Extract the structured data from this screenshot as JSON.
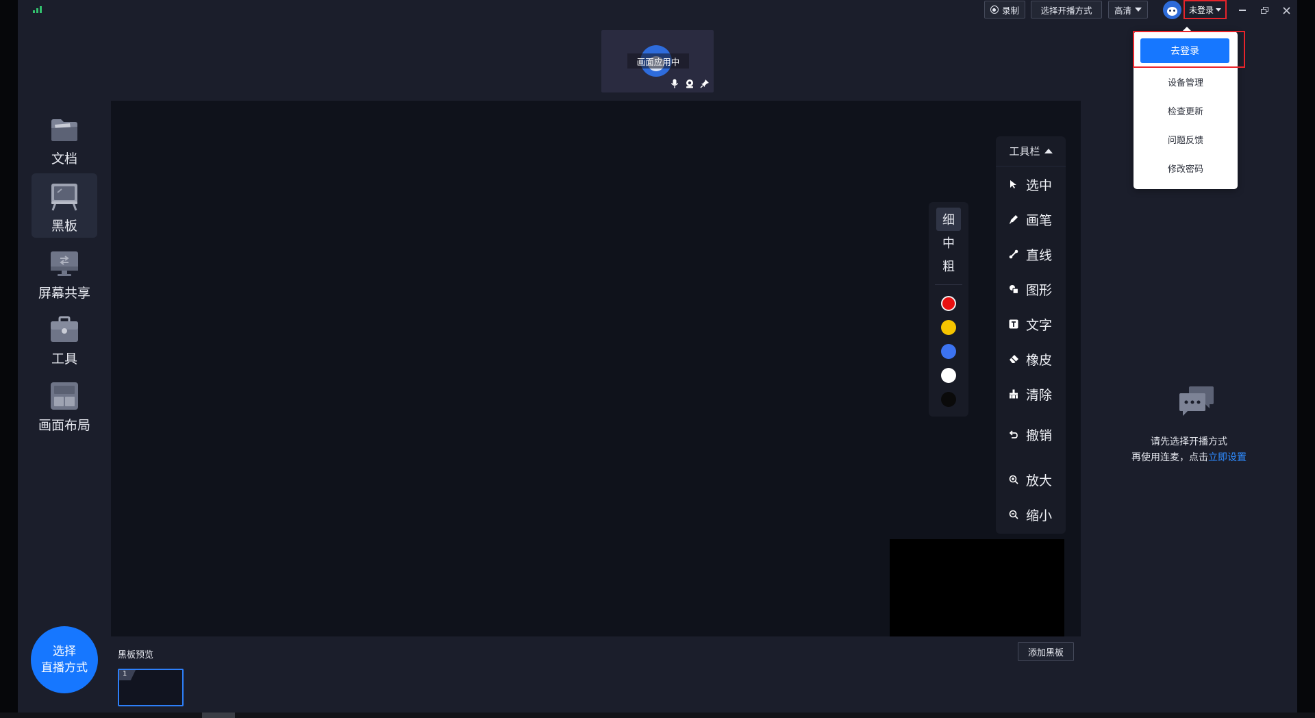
{
  "titlebar": {
    "record_label": "录制",
    "broadcast_mode_label": "选择开播方式",
    "quality_label": "高清",
    "login_status_label": "未登录"
  },
  "video": {
    "status_label": "画面应用中"
  },
  "sidebar": {
    "items": [
      {
        "label": "文档",
        "icon": "folder-icon"
      },
      {
        "label": "黑板",
        "icon": "blackboard-icon"
      },
      {
        "label": "屏幕共享",
        "icon": "monitor-icon"
      },
      {
        "label": "工具",
        "icon": "toolbox-icon"
      },
      {
        "label": "画面布局",
        "icon": "layout-icon"
      }
    ],
    "active_index": 1,
    "cta_line1": "选择",
    "cta_line2": "直播方式"
  },
  "pen_panel": {
    "widths": [
      "细",
      "中",
      "粗"
    ],
    "selected_width": "细",
    "colors": [
      "#e81010",
      "#f5c400",
      "#3c73f0",
      "#ffffff",
      "#0a0a0a"
    ]
  },
  "toolbar": {
    "title": "工具栏",
    "tools": [
      {
        "label": "选中",
        "icon": "cursor-icon"
      },
      {
        "label": "画笔",
        "icon": "pen-icon"
      },
      {
        "label": "直线",
        "icon": "line-icon"
      },
      {
        "label": "图形",
        "icon": "shape-icon"
      },
      {
        "label": "文字",
        "icon": "text-icon"
      },
      {
        "label": "橡皮",
        "icon": "eraser-icon"
      },
      {
        "label": "清除",
        "icon": "clear-icon"
      },
      {
        "label": "撤销",
        "icon": "undo-icon"
      },
      {
        "label": "放大",
        "icon": "zoom-in-icon"
      },
      {
        "label": "缩小",
        "icon": "zoom-out-icon"
      }
    ]
  },
  "preview": {
    "label": "黑板预览",
    "add_label": "添加黑板",
    "page_number": "1"
  },
  "right_panel": {
    "hint_line1": "请先选择开播方式",
    "hint_line2": "再使用连麦，点击",
    "hint_link": "立即设置"
  },
  "dropdown": {
    "login_label": "去登录",
    "items": [
      "设备管理",
      "检查更新",
      "问题反馈",
      "修改密码"
    ]
  },
  "colors": {
    "accent": "#1677ff",
    "highlight": "#e8242b",
    "background": "#1b1e2b",
    "board": "#0f121b"
  }
}
